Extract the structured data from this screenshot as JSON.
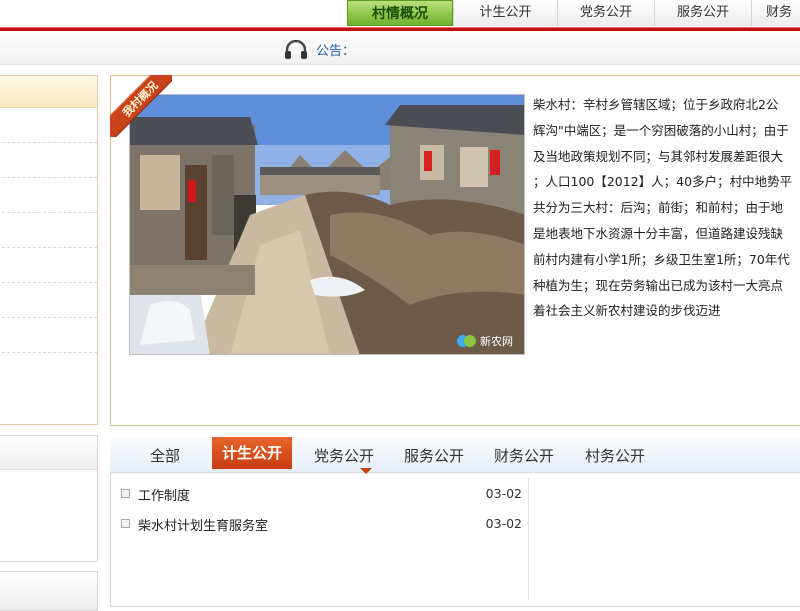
{
  "top_nav": {
    "tabs": [
      {
        "label": "村情概况",
        "active": true
      },
      {
        "label": "计生公开",
        "active": false
      },
      {
        "label": "党务公开",
        "active": false
      },
      {
        "label": "服务公开",
        "active": false
      },
      {
        "label": "财务",
        "active": false
      }
    ]
  },
  "notice": {
    "icon": "headphones-icon",
    "label": "公告："
  },
  "overview": {
    "ribbon": "我村概况",
    "photo_watermark": "新农网",
    "lines": [
      "柴水村：辛村乡管辖区域；位于乡政府北2公",
      "辉沟\"中端区；是一个穷困破落的小山村；由于",
      "及当地政策规划不同；与其邻村发展差距很大",
      "；人口100【2012】人；40多户；村中地势平",
      "共分为三大村：后沟；前街；和前村；由于地",
      "是地表地下水资源十分丰富，但道路建设残缺",
      "前村内建有小学1所；乡级卫生室1所；70年代",
      "种植为生；现在劳务输出已成为该村一大亮点",
      "着社会主义新农村建设的步伐迈进"
    ]
  },
  "info_tabs": {
    "tabs": [
      {
        "label": "全部",
        "active": false
      },
      {
        "label": "计生公开",
        "active": true
      },
      {
        "label": "党务公开",
        "active": false
      },
      {
        "label": "服务公开",
        "active": false
      },
      {
        "label": "财务公开",
        "active": false
      },
      {
        "label": "村务公开",
        "active": false
      }
    ],
    "items": [
      {
        "title": "工作制度",
        "date": "03-02"
      },
      {
        "title": "柴水村计划生育服务室",
        "date": "03-02"
      }
    ]
  },
  "colors": {
    "accent_red": "#c40f0f",
    "active_tab_green": "#6eb22a",
    "active_tab_orange": "#c63d10",
    "notice_blue": "#1f5ea8"
  }
}
